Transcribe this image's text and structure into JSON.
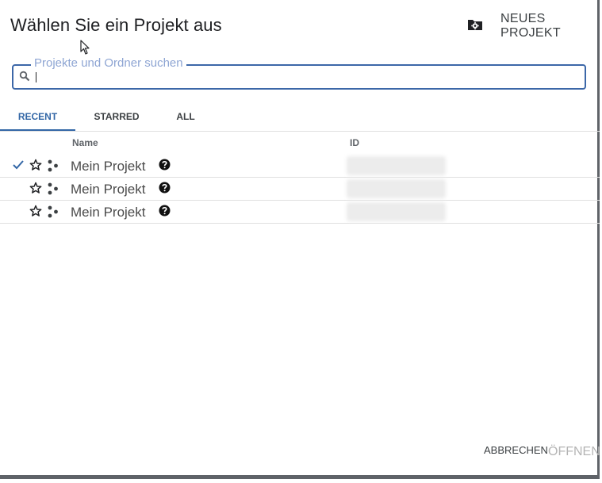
{
  "dialog": {
    "title": "Wählen Sie ein Projekt aus",
    "new_project_label": "NEUES PROJEKT",
    "new_project_icon": "folder-settings-icon"
  },
  "search": {
    "label": "Projekte und Ordner suchen",
    "value": "",
    "icon": "search-icon"
  },
  "tabs": [
    {
      "label": "RECENT",
      "active": true
    },
    {
      "label": "STARRED",
      "active": false
    },
    {
      "label": "ALL",
      "active": false
    }
  ],
  "table": {
    "columns": {
      "name": "Name",
      "id": "ID"
    },
    "rows": [
      {
        "name": "Mein Projekt",
        "selected": true
      },
      {
        "name": "Mein Projekt",
        "selected": false
      },
      {
        "name": "Mein Projekt",
        "selected": false
      }
    ]
  },
  "footer": {
    "cancel_label": "ABBRECHEN",
    "open_label": "ÖFFNEN"
  },
  "colors": {
    "accent": "#3367a6",
    "search_border": "#3c67a8",
    "label_muted": "#8ea5d3",
    "disabled": "#b4b4b4"
  }
}
